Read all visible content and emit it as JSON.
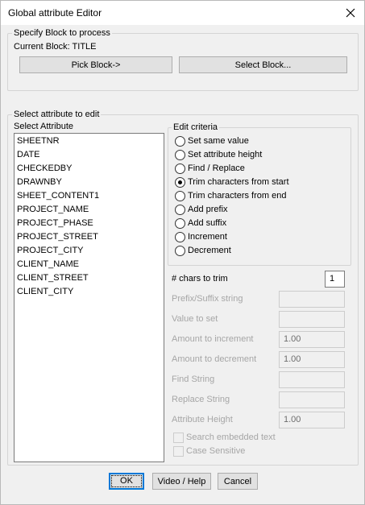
{
  "window": {
    "title": "Global attribute Editor"
  },
  "block_group": {
    "label": "Specify Block to process",
    "current_block": "Current Block: TITLE",
    "pick_button": "Pick Block->",
    "select_button": "Select Block..."
  },
  "attr_group": {
    "label": "Select attribute to edit",
    "list_label": "Select Attribute",
    "attributes": [
      "SHEETNR",
      "DATE",
      "CHECKEDBY",
      "DRAWNBY",
      "SHEET_CONTENT1",
      "PROJECT_NAME",
      "PROJECT_PHASE",
      "PROJECT_STREET",
      "PROJECT_CITY",
      "CLIENT_NAME",
      "CLIENT_STREET",
      "CLIENT_CITY"
    ]
  },
  "edit_criteria": {
    "label": "Edit criteria",
    "options": [
      "Set same value",
      "Set attribute height",
      "Find / Replace",
      "Trim characters from start",
      "Trim characters from end",
      "Add prefix",
      "Add suffix",
      "Increment",
      "Decrement"
    ],
    "selected": "Trim characters from start"
  },
  "fields": {
    "chars_to_trim": {
      "label": "# chars to trim",
      "value": "1"
    },
    "prefix_suffix": {
      "label": "Prefix/Suffix string",
      "value": ""
    },
    "value_to_set": {
      "label": "Value to set",
      "value": ""
    },
    "amount_increment": {
      "label": "Amount to increment",
      "value": "1.00"
    },
    "amount_decrement": {
      "label": "Amount to decrement",
      "value": "1.00"
    },
    "find_string": {
      "label": "Find String",
      "value": ""
    },
    "replace_string": {
      "label": "Replace String",
      "value": ""
    },
    "attribute_height": {
      "label": "Attribute Height",
      "value": "1.00"
    }
  },
  "checks": {
    "search_embedded": "Search embedded text",
    "case_sensitive": "Case Sensitive"
  },
  "footer": {
    "ok": "OK",
    "video_help": "Video / Help",
    "cancel": "Cancel"
  }
}
